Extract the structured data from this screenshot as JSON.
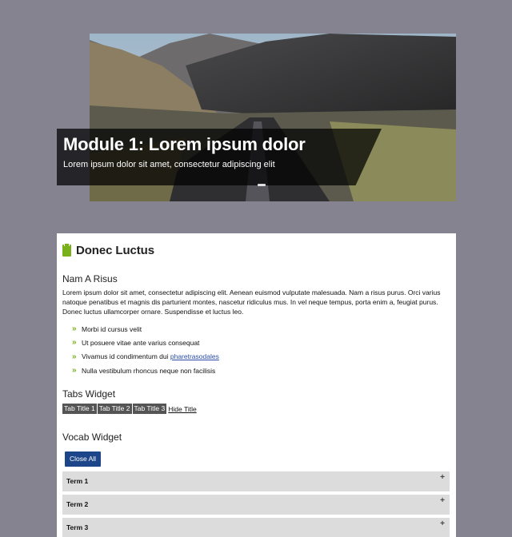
{
  "hero": {
    "title": "Module 1: Lorem ipsum dolor",
    "subtitle": "Lorem ipsum dolor sit amet, consectetur adipiscing elit"
  },
  "card": {
    "icon": "clipboard-icon",
    "accent_color": "#78b11b",
    "title": "Donec Luctus",
    "section1": {
      "heading": "Nam A Risus",
      "paragraph": "Lorem ipsum dolor sit amet, consectetur adipiscing elit. Aenean euismod vulputate malesuada. Nam a risus purus. Orci varius natoque penatibus et magnis dis parturient montes, nascetur ridiculus mus. In vel neque tempus, porta enim a, feugiat purus. Donec luctus ullamcorper ornare. Suspendisse et luctus leo.",
      "bullets": [
        {
          "marker": "»",
          "text": "Morbi id cursus velit"
        },
        {
          "marker": "»",
          "text": "Ut posuere vitae ante varius consequat"
        },
        {
          "marker": "»",
          "text": "Vivamus id condimentum dui ",
          "link": "pharetrasodales"
        },
        {
          "marker": "»",
          "text": "Nulla vestibulum rhoncus neque non facilisis"
        }
      ]
    },
    "tabs_widget": {
      "heading": "Tabs Widget",
      "tabs": [
        "Tab Title 1",
        "Tab Title 2",
        "Tab Title 3"
      ],
      "hide_title": "Hide Title"
    },
    "vocab_widget": {
      "heading": "Vocab Widget",
      "close_all": "Close All",
      "button_color": "#1c4689",
      "terms": [
        {
          "label": "Term 1",
          "toggle": "+"
        },
        {
          "label": "Term 2",
          "toggle": "+"
        },
        {
          "label": "Term 3",
          "toggle": "+"
        }
      ]
    }
  }
}
